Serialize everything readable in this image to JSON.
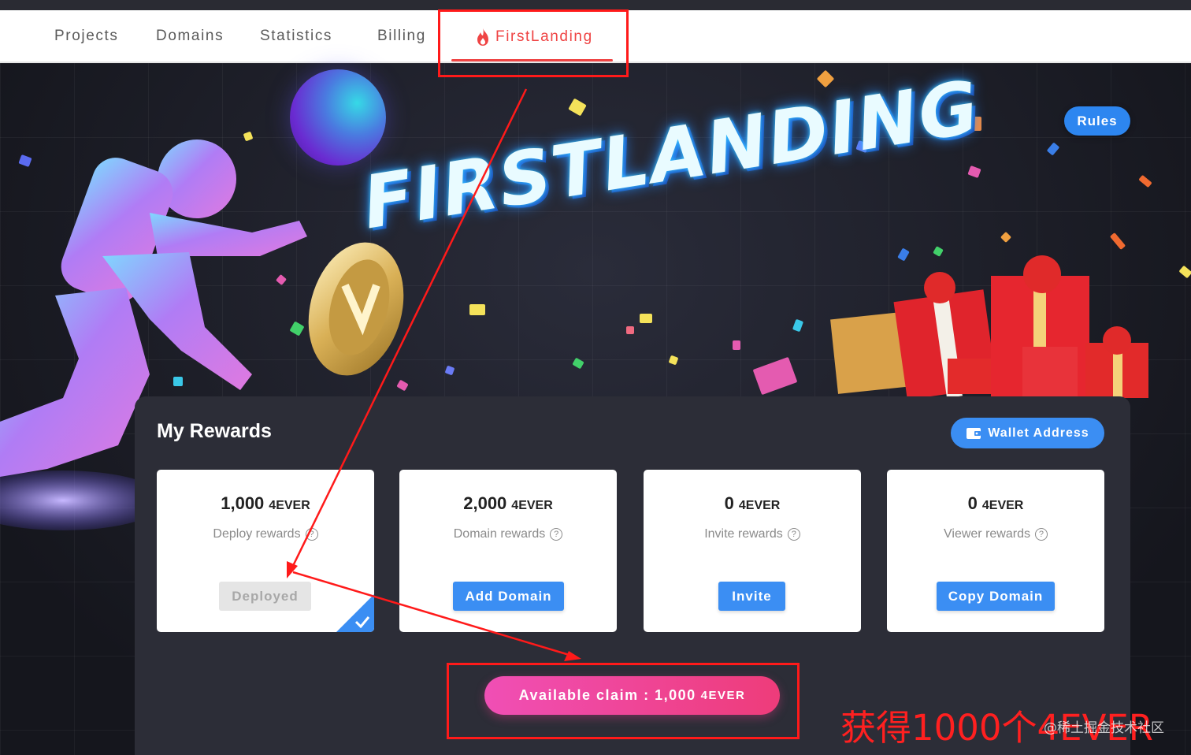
{
  "nav": {
    "items": [
      {
        "label": "Projects"
      },
      {
        "label": "Domains"
      },
      {
        "label": "Statistics"
      },
      {
        "label": "Billing"
      },
      {
        "label": "FirstLanding"
      }
    ]
  },
  "banner": {
    "title": "FIRSTLANDING"
  },
  "rules_label": "Rules",
  "rewards": {
    "title": "My Rewards",
    "wallet_label": "Wallet Address",
    "cards": [
      {
        "amount": "1,000",
        "unit": "4EVER",
        "label": "Deploy rewards",
        "button": "Deployed"
      },
      {
        "amount": "2,000",
        "unit": "4EVER",
        "label": "Domain rewards",
        "button": "Add Domain"
      },
      {
        "amount": "0",
        "unit": "4EVER",
        "label": "Invite rewards",
        "button": "Invite"
      },
      {
        "amount": "0",
        "unit": "4EVER",
        "label": "Viewer rewards",
        "button": "Copy Domain"
      }
    ],
    "claim_label": "Available claim : 1,000",
    "claim_unit": "4EVER"
  },
  "annotation": {
    "text": "获得1000个4EVER"
  },
  "watermark": "@稀土掘金技术社区",
  "colors": {
    "accent": "#3b8ef3",
    "active_tab": "#ef4444",
    "annotation": "#ff1a1a",
    "claim_gradient_start": "#f04fb5",
    "claim_gradient_end": "#ee3c7a"
  }
}
